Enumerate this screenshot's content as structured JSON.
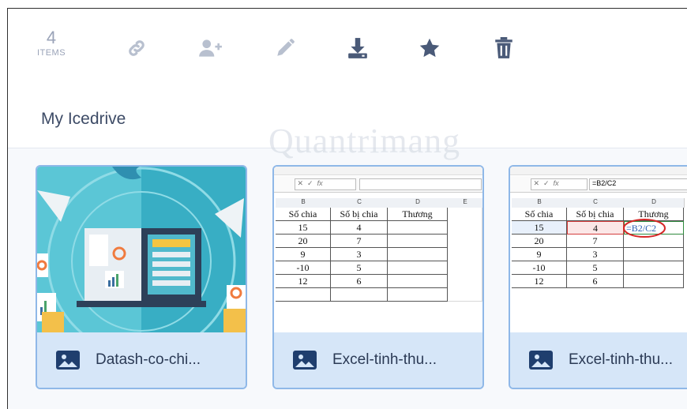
{
  "toolbar": {
    "count": "4",
    "count_label": "ITEMS"
  },
  "section_title": "My Icedrive",
  "watermark": "Quantrimang",
  "files": [
    {
      "name": "Datash-co-chi..."
    },
    {
      "name": "Excel-tinh-thu..."
    },
    {
      "name": "Excel-tinh-thu..."
    }
  ],
  "sheet": {
    "col_headers": [
      "B",
      "C",
      "D",
      "E"
    ],
    "headers": [
      "Số chia",
      "Số bị chia",
      "Thương"
    ],
    "rows": [
      [
        "15",
        "4",
        ""
      ],
      [
        "20",
        "7",
        ""
      ],
      [
        "9",
        "3",
        ""
      ],
      [
        "-10",
        "5",
        ""
      ],
      [
        "12",
        "6",
        ""
      ]
    ],
    "formula": "=B2/C2",
    "cell_formula": "=B2/C2"
  },
  "colors": {
    "accent": "#8fb8e8",
    "card_bg": "#d6e6f8",
    "icon": "#4a5a78",
    "icon_muted": "#b8c0cf"
  }
}
